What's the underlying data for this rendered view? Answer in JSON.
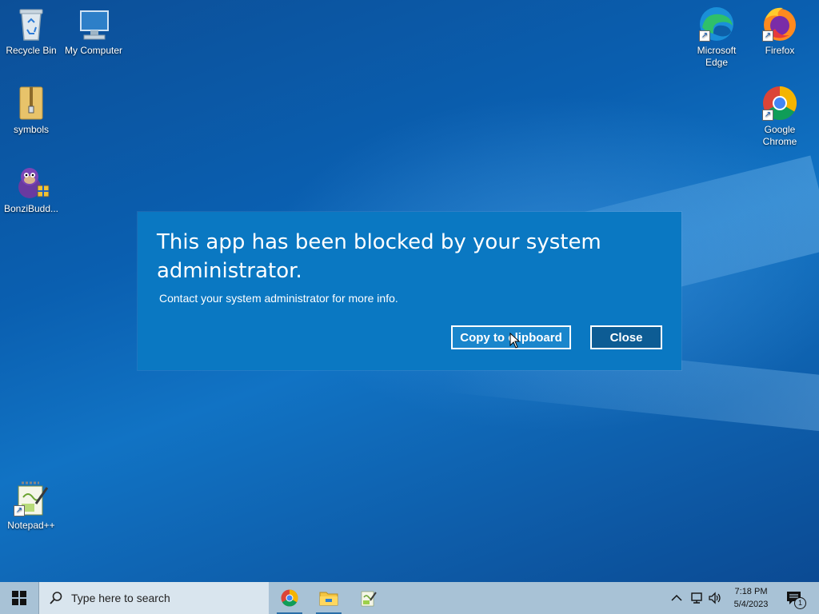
{
  "desktop": {
    "icons_left": [
      {
        "label": "Recycle Bin"
      },
      {
        "label": "My Computer"
      },
      {
        "label": "symbols"
      },
      {
        "label": "BonziBudd..."
      },
      {
        "label": "Notepad++"
      }
    ],
    "icons_right": [
      {
        "label": "Microsoft Edge"
      },
      {
        "label": "Firefox"
      },
      {
        "label": "Google Chrome"
      }
    ]
  },
  "dialog": {
    "title": "This app has been blocked by your system administrator.",
    "message": "Contact your system administrator for more info.",
    "copy_label": "Copy to clipboard",
    "close_label": "Close"
  },
  "taskbar": {
    "search_placeholder": "Type here to search",
    "pinned": [
      "google-chrome-icon",
      "file-explorer-icon",
      "notepad-plus-plus-icon"
    ],
    "clock_time": "7:18 PM",
    "clock_date": "5/4/2023",
    "notification_count": "1"
  },
  "colors": {
    "dialog_bg": "#0a78c2",
    "taskbar_bg": "#a8c2d6",
    "desktop_bg": "#0a5fb0"
  }
}
